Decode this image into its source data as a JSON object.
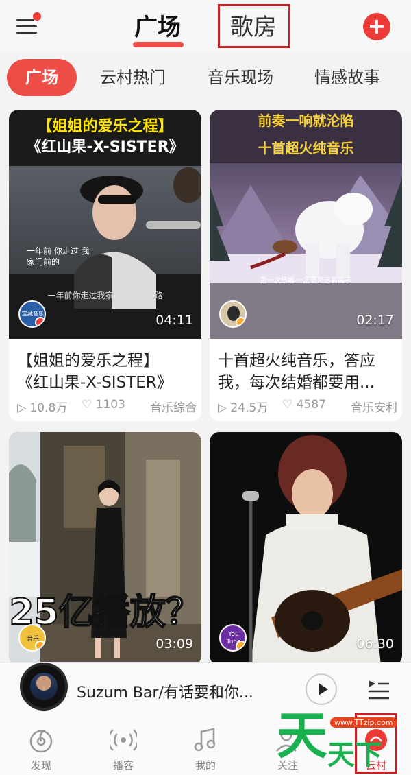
{
  "header": {
    "tab_active": "广场",
    "tab_room": "歌房",
    "add_label": "+"
  },
  "categories": [
    "广场",
    "云村热门",
    "音乐现场",
    "情感故事"
  ],
  "cards": [
    {
      "overlay_line1": "【姐姐的爱乐之程】",
      "overlay_line2": "《红山果-X-SISTER》",
      "subtitle_overlay": "一年前你走过我家门前的那条路",
      "lyric_overlay": "一年前 你走过 我家门前的",
      "duration": "04:11",
      "avatar_text": "宝藏音乐",
      "title_line1": "【姐姐的爱乐之程】",
      "title_line2": "《红山果-X-SISTER》",
      "plays": "10.8万",
      "likes": "1103",
      "channel": "音乐综合"
    },
    {
      "overlay_line1": "前奏一响就沦陷",
      "overlay_line2": "十首超火纯音乐",
      "subtitle_overlay": "第一次结婚 一定要用这首曲子",
      "duration": "02:17",
      "title_line1": "十首超火纯音乐，答应",
      "title_line2": "我，每次结婚都要用...",
      "plays": "24.5万",
      "likes": "4587",
      "channel": "音乐安利"
    },
    {
      "overlay_big": "25亿播放？",
      "duration": "03:09",
      "avatar_text": "音乐"
    },
    {
      "avatar_text": "You Tube",
      "duration": "06:30"
    }
  ],
  "player": {
    "song": "Suzum Bar/有话要和你..."
  },
  "nav": [
    {
      "label": "发现",
      "icon": "discover-icon"
    },
    {
      "label": "播客",
      "icon": "podcast-icon"
    },
    {
      "label": "我的",
      "icon": "music-note-icon"
    },
    {
      "label": "关注",
      "icon": "follow-icon"
    },
    {
      "label": "云村",
      "icon": "cloud-village-icon"
    }
  ],
  "watermark": {
    "big": "天",
    "small": "www.TTzip.com",
    "text": "天下载"
  },
  "colors": {
    "accent": "#ec3a36",
    "highlight_box": "#c81e24",
    "watermark_green": "#19b14f"
  }
}
